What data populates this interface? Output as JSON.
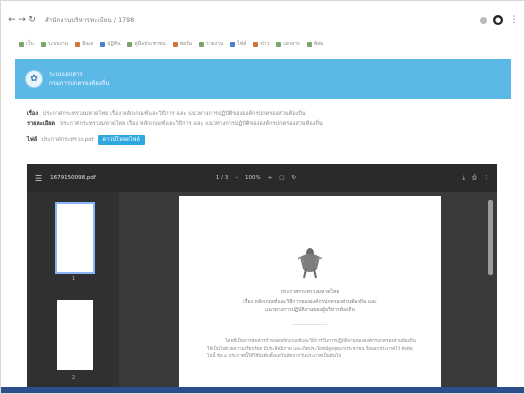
{
  "browser": {
    "url": "สำนักงานบริหารทะเบียน / 1798",
    "back_icon": "back-arrow-icon",
    "forward_icon": "forward-arrow-icon",
    "bookmarks": [
      "เว็บ",
      "ระบบงาน",
      "อีเมล",
      "ปฏิทิน",
      "คู่มือประชาชน",
      "ฟอร์ม",
      "รายงาน",
      "ไฟล์",
      "ข่าว",
      "เอกสาร",
      "พัสดุ"
    ]
  },
  "site": {
    "title_line1": "ระบบเอกสาร",
    "title_line2": "กรมการปกครองท้องถิ่น"
  },
  "content": {
    "subject_label": "เรื่อง",
    "subject_text": "ประกาศกระทรวงมหาดไทย เรื่อง หลักเกณฑ์และวิธีการ และ แนวทางการปฏิบัติขององค์กรปกครองส่วนท้องถิ่น",
    "detail_label": "รายละเอียด",
    "detail_text": "ประกาศกระทรวงมหาดไทย เรื่อง หลักเกณฑ์และวิธีการ และ แนวทางการปฏิบัติขององค์กรปกครองส่วนท้องถิ่น",
    "file_label": "ไฟล์",
    "file_name": "ประกาศกระทรวง.pdf",
    "download_label": "ดาวน์โหลดไฟล์"
  },
  "viewer": {
    "file_name": "1679150098.pdf",
    "page_info": "1 / 3",
    "zoom": "100%",
    "thumbnail_numbers": [
      "1",
      "2"
    ],
    "page_heading": "ประกาศกระทรวงมหาดไทย",
    "page_subject_line1": "เรื่อง หลักเกณฑ์และวิธีการขององค์กรปกครองส่วนท้องถิ่น และ",
    "page_subject_line2": "แนวทางการปฏิบัติงานของผู้บริหารท้องถิ่น",
    "page_body": "โดยที่เป็นการสมควรกำหนดหลักเกณฑ์และวิธีการในการปฏิบัติงานขององค์กรปกครองส่วนท้องถิ่น ให้เป็นไปด้วยความเรียบร้อย มีประสิทธิภาพ และเกิดประโยชน์สูงสุดแก่ประชาชน จึงออกประกาศไว้ ดังต่อไปนี้ ข้อ ๑ ประกาศนี้ให้ใช้บังคับตั้งแต่วันถัดจากวันประกาศเป็นต้นไป"
  },
  "colors": {
    "header_bg": "#5cb8e6",
    "download_btn": "#2fa8e0",
    "viewer_bg": "#3a3a3a"
  }
}
